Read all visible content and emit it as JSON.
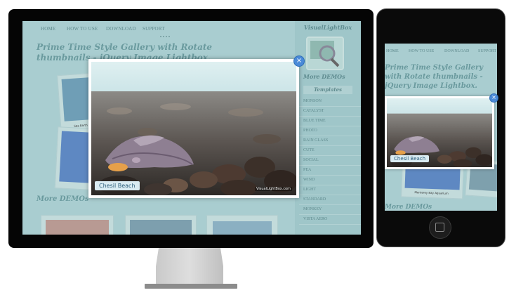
{
  "nav": {
    "items": [
      "HOME",
      "HOW TO USE",
      "DOWNLOAD",
      "SUPPORT"
    ]
  },
  "page": {
    "title": "Prime Time Style Gallery with Rotate thumbnails - jQuery Image Lightbox.",
    "mobile_title": "Prime Time Style Gallery with Rotate thumbnails - jQuery Image Lightbox.",
    "more_demos": "More DEMOs"
  },
  "sidebar": {
    "title": "VisualLightBox",
    "more_demos": "More DEMOs",
    "templates_heading": "Templates",
    "templates": [
      "MONSON",
      "CATALYST",
      "BLUE TIME",
      "PHOTO",
      "RAIN GLASS",
      "CUTE",
      "SOCIAL",
      "PEA",
      "WIND",
      "LIGHT",
      "STANDARD",
      "MONKEY",
      "VISTA AERO"
    ]
  },
  "lightbox": {
    "caption": "Chesil Beach",
    "credit": "VisualLightBox.com",
    "close_symbol": "×"
  },
  "thumbnails": {
    "first_caption": "Sea Earth",
    "phone_caption": "Monterey Bay Aquarium"
  },
  "colors": {
    "overlay": "#a9cdd0",
    "device_frame": "#050505",
    "caption_bg": "#d9ebf2",
    "caption_text": "#2b5d7a",
    "close_button": "#4a8ad8"
  },
  "icons": {
    "close": "close-icon",
    "phone_home": "home-button-icon",
    "sidebar_logo": "magnifier-logo-icon"
  }
}
